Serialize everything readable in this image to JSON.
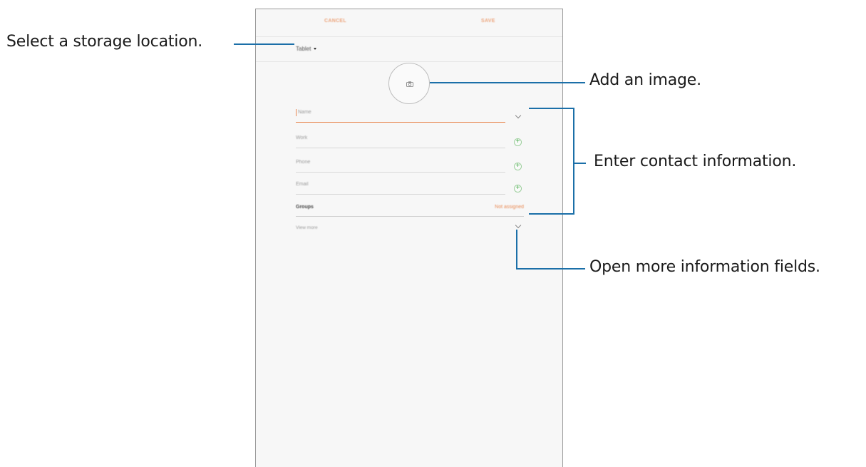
{
  "screen": {
    "action_bar": {
      "cancel_label": "CANCEL",
      "save_label": "SAVE"
    },
    "storage": {
      "label": "Tablet",
      "icon": "dropdown-arrow"
    },
    "photo": {
      "icon": "camera-icon"
    },
    "fields": {
      "name_placeholder": "Name",
      "work_placeholder": "Work",
      "phone_placeholder": "Phone",
      "email_placeholder": "Email"
    },
    "groups": {
      "label": "Groups",
      "value": "Not assigned"
    },
    "view_more_label": "View more"
  },
  "callouts": {
    "storage": "Select a storage location.",
    "image": "Add an image.",
    "contact_info": "Enter contact information.",
    "more_fields": "Open more information fields."
  },
  "colors": {
    "accent": "#e98a54",
    "callout_line": "#1b6fa8",
    "plus_icon": "#4caf50"
  }
}
